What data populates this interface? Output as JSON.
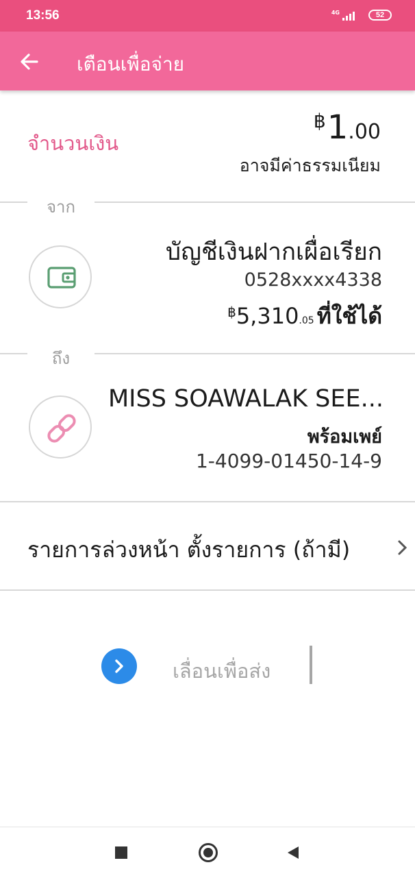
{
  "status_bar": {
    "time": "13:56",
    "network": "4G",
    "battery": "52"
  },
  "app_bar": {
    "title": "เตือนเพื่อจ่าย",
    "back_icon": "arrow-left-icon"
  },
  "amount": {
    "label": "จำนวนเงิน",
    "currency": "฿",
    "integer": "1",
    "decimal": ".00",
    "fee_note": "อาจมีค่าธรรมเนียม"
  },
  "from": {
    "section_label": "จาก",
    "icon": "wallet-icon",
    "account_name": "บัญชีเงินฝากเผื่อเรียก",
    "account_number": "0528xxxx4338",
    "balance_currency": "฿",
    "balance_integer": "5,310",
    "balance_decimal": ".05",
    "balance_suffix": "ที่ใช้ได้"
  },
  "to": {
    "section_label": "ถึง",
    "icon": "link-icon",
    "payee_name": "MISS SOAWALAK  SEE...",
    "service": "พร้อมเพย์",
    "id": "1-4099-01450-14-9"
  },
  "schedule": {
    "label": "รายการล่วงหน้า  ตั้งรายการ (ถ้ามี)",
    "icon": "chevron-right-icon"
  },
  "slider": {
    "label": "เลื่อนเพื่อส่ง",
    "icon": "chevron-right-icon"
  },
  "nav": {
    "recents_icon": "square-icon",
    "home_icon": "circle-icon",
    "back_icon": "triangle-back-icon"
  },
  "colors": {
    "status_bar": "#ea4f7e",
    "app_bar": "#f2689a",
    "accent_pink": "#e2588a",
    "slider_blue": "#2c8be8",
    "wallet_green": "#5a9e72"
  }
}
